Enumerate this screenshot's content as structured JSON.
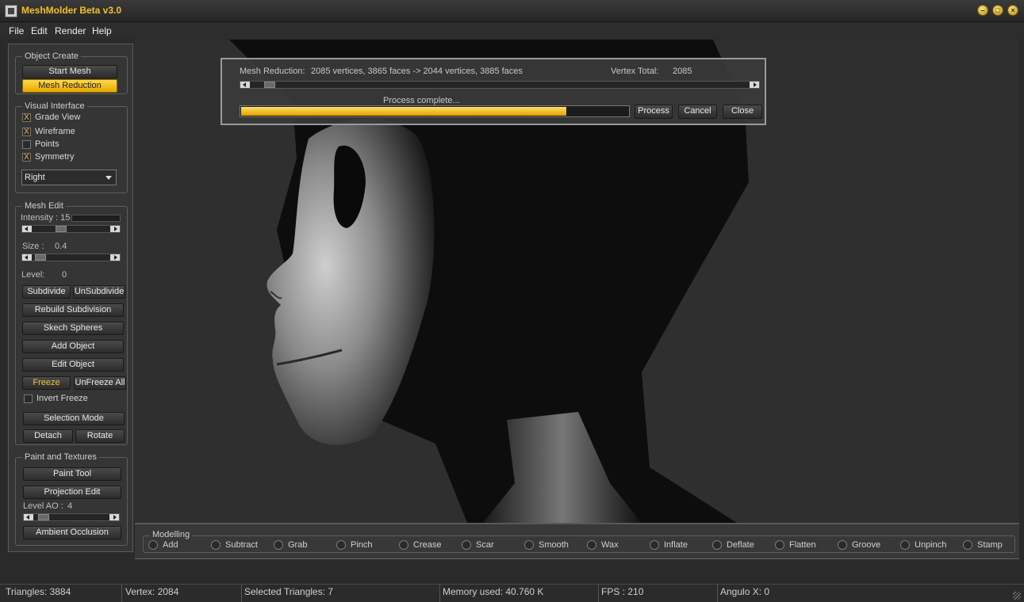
{
  "window": {
    "title": "MeshMolder Beta v3.0",
    "min_icon": "minimize-icon",
    "max_icon": "maximize-icon",
    "close_icon": "close-icon"
  },
  "menu": {
    "file": "File",
    "edit": "Edit",
    "render": "Render",
    "help": "Help"
  },
  "colors": {
    "accent": "#f2c12e",
    "background": "#2f2f2f",
    "panel": "#353535"
  },
  "object_create": {
    "title": "Object Create",
    "start_mesh": "Start Mesh",
    "mesh_reduction": "Mesh Reduction"
  },
  "visual_interface": {
    "title": "Visual Interface",
    "grade_view": {
      "label": "Grade View",
      "checked": true,
      "mark": "X"
    },
    "wireframe": {
      "label": "Wireframe",
      "checked": true,
      "mark": "X"
    },
    "points": {
      "label": "Points",
      "checked": false,
      "mark": ""
    },
    "symmetry": {
      "label": "Symmetry",
      "checked": true,
      "mark": "X"
    },
    "view_select": "Right"
  },
  "mesh_edit": {
    "title": "Mesh Edit",
    "intensity_label": "Intensity : 15",
    "intensity_value": 15,
    "size_label": "Size :",
    "size_value": "0.4",
    "level_label": "Level:",
    "level_value": "0",
    "subdivide": "Subdivide",
    "unsubdivide": "UnSubdivide",
    "rebuild_subdivision": "Rebuild Subdivision",
    "sketch_spheres": "Skech Spheres",
    "add_object": "Add Object",
    "edit_object": "Edit Object",
    "freeze": "Freeze",
    "unfreeze_all": "UnFreeze All",
    "invert_freeze": {
      "label": "Invert Freeze",
      "checked": false,
      "mark": ""
    },
    "selection_mode": "Selection Mode",
    "detach": "Detach",
    "rotate": "Rotate"
  },
  "paint_textures": {
    "title": "Paint and Textures",
    "paint_tool": "Paint Tool",
    "projection_edit": "Projection Edit",
    "level_ao_label": "Level AO :",
    "level_ao_value": "4",
    "ambient_occlusion": "Ambient Occlusion"
  },
  "dialog": {
    "label": "Mesh Reduction:",
    "summary": "2085 vertices, 3865 faces -> 2044 vertices, 3885 faces",
    "vertex_total_label": "Vertex Total:",
    "vertex_total_value": "2085",
    "status": "Process complete...",
    "progress": 0.84,
    "process": "Process",
    "cancel": "Cancel",
    "close": "Close"
  },
  "modelling": {
    "title": "Modelling",
    "tools": [
      "Add",
      "Subtract",
      "Grab",
      "Pinch",
      "Crease",
      "Scar",
      "Smooth",
      "Wax",
      "Inflate",
      "Deflate",
      "Flatten",
      "Groove",
      "Unpinch",
      "Stamp"
    ]
  },
  "status": {
    "triangles": "Triangles: 3884",
    "vertex": "Vertex: 2084",
    "selected": "Selected Triangles: 7",
    "memory": "Memory used: 40.760 K",
    "fps": "FPS : 210",
    "angulo": "Angulo X: 0"
  }
}
